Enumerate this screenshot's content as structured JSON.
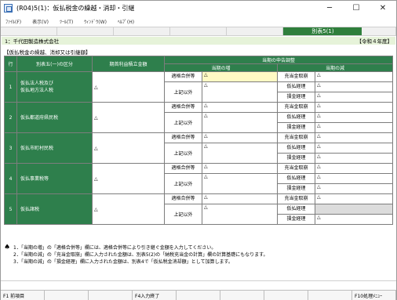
{
  "window": {
    "title": "(R04)5(1)：仮払税金の繰越・消却・引継",
    "controls": [
      "─",
      "☐",
      "✕"
    ]
  },
  "menu": [
    "ﾌｧｲﾙ(F)",
    "表示(V)",
    "ﾂｰﾙ(T)",
    "ｳｨﾝﾄﾞｳ(W)",
    "ﾍﾙﾌﾟ(H)"
  ],
  "tab": {
    "active_label": "別表5(1)"
  },
  "company": {
    "name": "1：千代田製造株式会社",
    "era": "【令和４年度】"
  },
  "form_title": "【仮払税金の繰越、消却又は引継額】",
  "table": {
    "headers": {
      "row": "行",
      "kind": "別表五(一)の区分",
      "opening": "期首利益積立金額",
      "adjust": "当期の申告調整",
      "increase": "当期の増",
      "decrease": "当期の減"
    },
    "sub_labels": {
      "merger": "適格合併等",
      "other": "上記以外",
      "refund": "充当金取崩",
      "temp": "仮払経理",
      "loss": "損金経理"
    },
    "triangle": "△",
    "rows": [
      {
        "no": "1",
        "label": "仮払法人税及び\n仮払地方法人税"
      },
      {
        "no": "2",
        "label": "仮払都道府県民税"
      },
      {
        "no": "3",
        "label": "仮払市町村民税"
      },
      {
        "no": "4",
        "label": "仮払事業税等"
      },
      {
        "no": "5",
        "label": "仮払諸税"
      }
    ]
  },
  "notes": [
    "1．「当期の増」の「適格合併等」欄には、適格合併等により引き継ぐ金額を入力してください。",
    "2．「当期の減」の「充当金取崩」欄に入力された金額は、別表5(2)の「納税充当金の計算」欄の計算基礎にもなります。",
    "3．「当期の減」の「損金経理」欄に入力された金額は、別表4で「仮払税金消却額」として加算します。"
  ],
  "fkeys": [
    "F1 前項目",
    "",
    "",
    "F4入力終了",
    "",
    "",
    "",
    "",
    "F10処理ﾒﾆｭｰ"
  ]
}
